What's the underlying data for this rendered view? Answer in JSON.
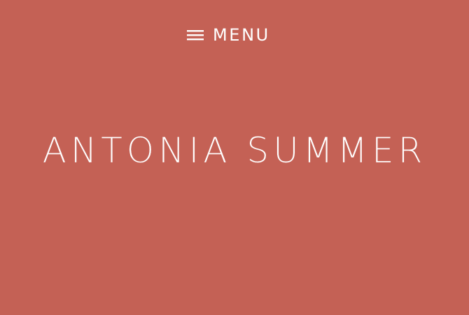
{
  "theme": {
    "background": "#c46155",
    "text_color": "#ffffff"
  },
  "header": {
    "menu_icon": "hamburger-menu-icon",
    "menu_label": "MENU"
  },
  "hero": {
    "site_title": "ANTONIA SUMMER"
  }
}
